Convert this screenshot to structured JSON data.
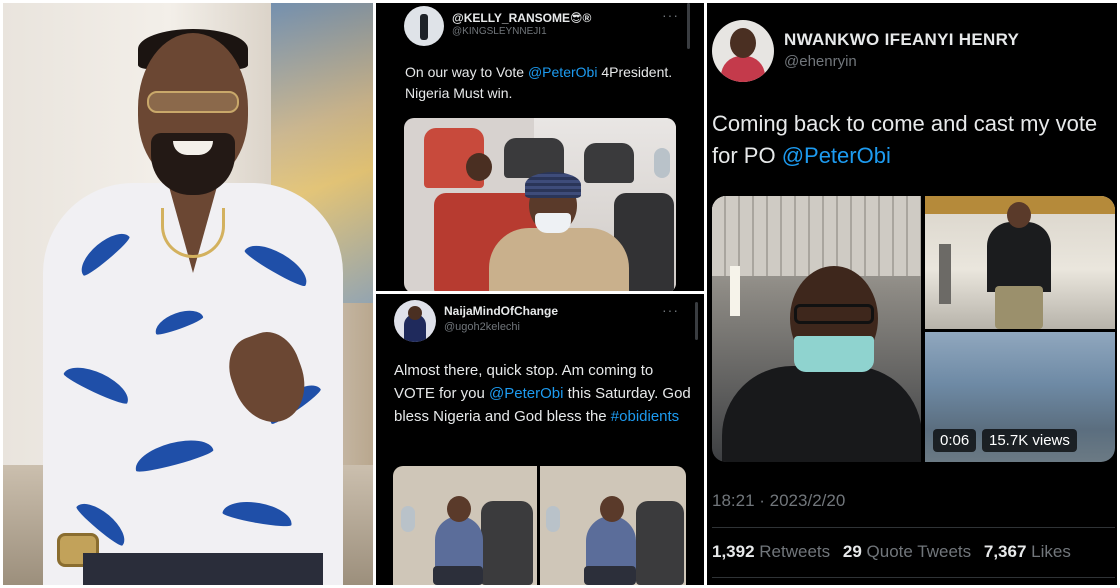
{
  "tweet1": {
    "name": "@KELLY_RANSOME😎®",
    "handle": "@KINGSLEYNNEJI1",
    "text_pre": "On our way to  Vote ",
    "mention": "@PeterObi",
    "text_post": " 4President. Nigeria Must win."
  },
  "tweet2": {
    "name": "NaijaMindOfChange",
    "handle": "@ugoh2kelechi",
    "text_pre": "Almost there, quick stop. Am coming to VOTE for you ",
    "mention": "@PeterObi",
    "text_mid": " this Saturday. God bless Nigeria and God bless the ",
    "hashtag": "#obidients"
  },
  "tweet3": {
    "name": "NWANKWO IFEANYI HENRY",
    "handle": "@ehenryin",
    "text_pre": "Coming back to come and cast my vote for PO ",
    "mention": "@PeterObi",
    "video_duration": "0:06",
    "video_views": "15.7K views",
    "timestamp": "18:21 · 2023/2/20",
    "retweets_count": "1,392",
    "retweets_label": "Retweets",
    "quotes_count": "29",
    "quotes_label": "Quote Tweets",
    "likes_count": "7,367",
    "likes_label": "Likes"
  },
  "icons": {
    "more": "more-options-icon"
  },
  "colors": {
    "background": "#000000",
    "text": "#e7e9ea",
    "secondary": "#71767b",
    "link": "#1d9bf0"
  }
}
